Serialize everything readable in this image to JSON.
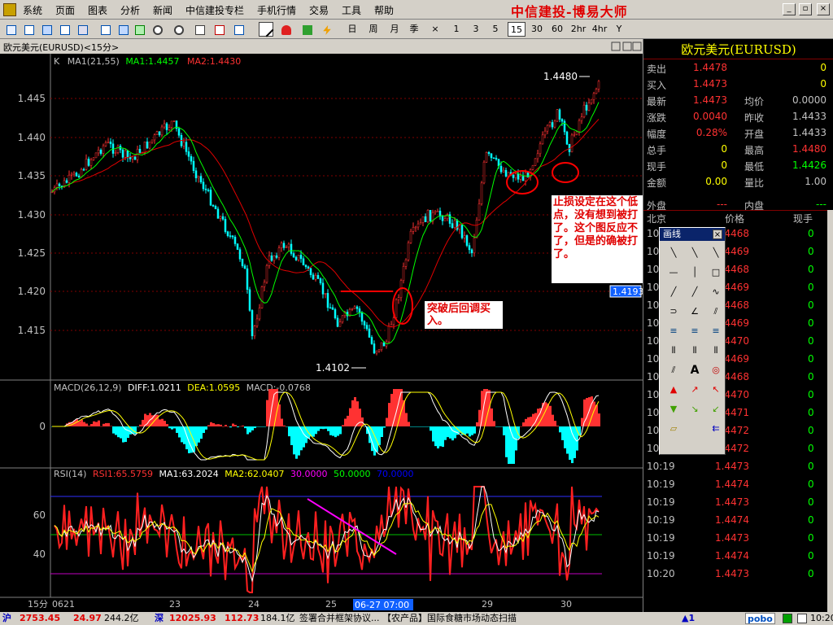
{
  "menu": {
    "items": [
      "系统",
      "页面",
      "图表",
      "分析",
      "新闻",
      "中信建投专栏",
      "手机行情",
      "交易",
      "工具",
      "帮助"
    ],
    "brand": "中信建投-博易大师"
  },
  "toolbar": {
    "periods": [
      "日",
      "周",
      "月",
      "季",
      "×",
      "1",
      "3",
      "5",
      "15",
      "30",
      "60",
      "2hr",
      "4hr",
      "Y"
    ],
    "selected": "15"
  },
  "chart": {
    "title": "欧元美元(EURUSD)<15分>",
    "legend": {
      "k": "K",
      "ma_label": "MA1(21,55)",
      "ma1": "MA1:1.4457",
      "ma2": "MA2:1.4430"
    },
    "price_ticks": [
      "1.445",
      "1.440",
      "1.435",
      "1.430",
      "1.425",
      "1.420",
      "1.415"
    ],
    "high_label": "1.4480",
    "low_label": "1.4102",
    "cursor_price": "1.4193",
    "macd": {
      "label": "MACD(26,12,9)",
      "diff": "DIFF:1.0211",
      "dea": "DEA:1.0595",
      "macd": "MACD:-0.0768",
      "zero_tick": "0"
    },
    "rsi": {
      "label": "RSI(14)",
      "rsi1": "RSI1:65.5759",
      "ma1": "MA1:63.2024",
      "ma2": "MA2:62.0407",
      "l30": "30.0000",
      "l50": "50.0000",
      "l70": "70.0000",
      "ticks": [
        "60",
        "40"
      ]
    },
    "x_axis": {
      "period": "15分",
      "labels": [
        "0621",
        "23",
        "24",
        "25",
        "29",
        "30"
      ],
      "cursor": "06-27 07:00"
    },
    "annotations": {
      "breakout": "突破后回调买入。",
      "stoploss": "止损设定在这个低点，没有想到被打了。这个图反应不了，但是的确被打了。"
    }
  },
  "quote": {
    "title": "欧元美元(EURUSD)",
    "rows": [
      [
        "卖出",
        "1.4478",
        "",
        "0"
      ],
      [
        "买入",
        "1.4473",
        "",
        "0"
      ],
      [
        "最新",
        "1.4473",
        "均价",
        "0.0000"
      ],
      [
        "涨跌",
        "0.0040",
        "昨收",
        "1.4433"
      ],
      [
        "幅度",
        "0.28%",
        "开盘",
        "1.4433"
      ],
      [
        "总手",
        "0",
        "最高",
        "1.4480"
      ],
      [
        "现手",
        "0",
        "最低",
        "1.4426"
      ],
      [
        "金额",
        "0.00",
        "量比",
        "1.00"
      ],
      [
        "外盘",
        "---",
        "内盘",
        "---"
      ]
    ],
    "tick_header": [
      "北京",
      "价格",
      "现手"
    ],
    "ticks": [
      [
        "10:",
        "1.4468",
        "0"
      ],
      [
        "10:",
        "1.4469",
        "0"
      ],
      [
        "10:",
        "1.4468",
        "0"
      ],
      [
        "10:",
        "1.4469",
        "0"
      ],
      [
        "10:",
        "1.4468",
        "0"
      ],
      [
        "10:",
        "1.4469",
        "0"
      ],
      [
        "10:",
        "1.4470",
        "0"
      ],
      [
        "10:",
        "1.4469",
        "0"
      ],
      [
        "10:",
        "1.4468",
        "0"
      ],
      [
        "10:",
        "1.4470",
        "0"
      ],
      [
        "10:",
        "1.4471",
        "0"
      ],
      [
        "10:",
        "1.4472",
        "0"
      ],
      [
        "10:19",
        "1.4472",
        "0"
      ],
      [
        "10:19",
        "1.4473",
        "0"
      ],
      [
        "10:19",
        "1.4474",
        "0"
      ],
      [
        "10:19",
        "1.4473",
        "0"
      ],
      [
        "10:19",
        "1.4474",
        "0"
      ],
      [
        "10:19",
        "1.4473",
        "0"
      ],
      [
        "10:19",
        "1.4474",
        "0"
      ],
      [
        "10:20",
        "1.4473",
        "0"
      ]
    ]
  },
  "draw_tool": {
    "title": "画线",
    "close": "×",
    "text_tool": "A"
  },
  "status": {
    "sh_label": "沪",
    "sh_val": "2753.45",
    "sh_chg": "24.97",
    "sh_amt": "244.2亿",
    "sz_label": "深",
    "sz_val": "12025.93",
    "sz_chg": "112.73",
    "sz_amt": "184.1亿",
    "news": "签署合并框架协议...  【农产品】国际食糖市场动态扫描",
    "alert": "▲1",
    "logo": "pobo",
    "time": "10:20"
  },
  "colors": {
    "up": "#ff3232",
    "down": "#00ffff",
    "ma1": "#00ff00",
    "ma2": "#ff0000",
    "grid": "#800000",
    "yellow": "#ffff00"
  }
}
